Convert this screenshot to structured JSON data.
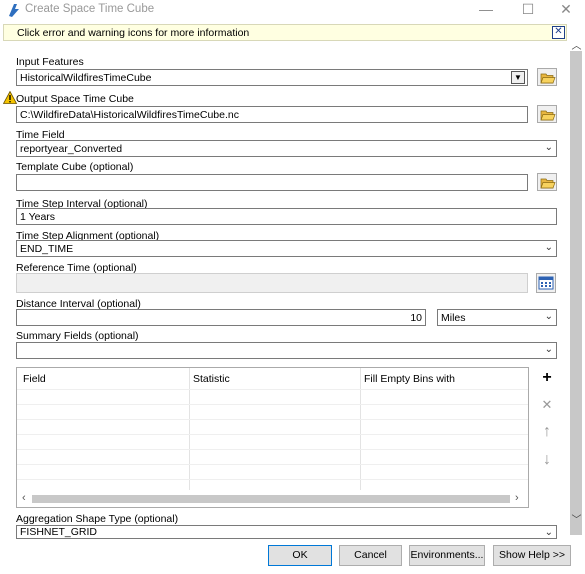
{
  "window": {
    "title": "Create Space Time Cube",
    "minimize_glyph": "—",
    "maximize_glyph": "☐",
    "close_glyph": "✕"
  },
  "infobar": {
    "message": "Click error and warning icons for more information",
    "close_glyph": "✕"
  },
  "form": {
    "input_features": {
      "label": "Input Features",
      "value": "HistoricalWildfiresTimeCube"
    },
    "output_cube": {
      "label": "Output Space Time Cube",
      "value": "C:\\WildfireData\\HistoricalWildfiresTimeCube.nc"
    },
    "time_field": {
      "label": "Time Field",
      "value": "reportyear_Converted"
    },
    "template_cube": {
      "label": "Template Cube (optional)",
      "value": ""
    },
    "time_step_interval": {
      "label": "Time Step Interval (optional)",
      "value": "1 Years"
    },
    "time_step_alignment": {
      "label": "Time Step Alignment (optional)",
      "value": "END_TIME"
    },
    "reference_time": {
      "label": "Reference Time (optional)",
      "value": ""
    },
    "distance_interval": {
      "label": "Distance Interval (optional)",
      "value": "10",
      "unit": "Miles"
    },
    "summary_fields": {
      "label": "Summary Fields (optional)",
      "value": ""
    },
    "aggregation_shape": {
      "label": "Aggregation Shape Type (optional)",
      "value": "FISHNET_GRID"
    }
  },
  "grid": {
    "columns": [
      "Field",
      "Statistic",
      "Fill Empty Bins with"
    ]
  },
  "side_buttons": {
    "add": "+",
    "remove": "✕",
    "up": "↑",
    "down": "↓"
  },
  "buttons": {
    "ok": "OK",
    "cancel": "Cancel",
    "environments": "Environments...",
    "show_help": "Show Help >>"
  },
  "colors": {
    "infobar_bg": "#ffffe1",
    "accent": "#0078d7",
    "warning": "#f5c400"
  },
  "icons": {
    "app": "app-icon",
    "warning": "warning-icon",
    "folder": "folder-open-icon",
    "calendar": "calendar-icon"
  }
}
